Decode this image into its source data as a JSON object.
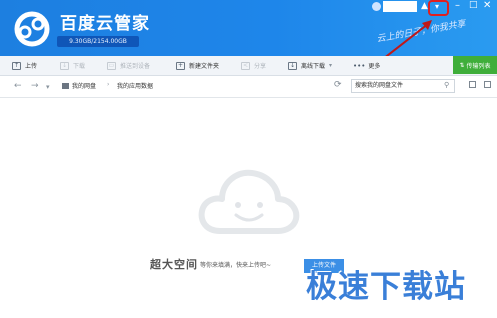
{
  "app": {
    "title": "百度云管家",
    "quota": "9.30GB/2154.00GB",
    "slogan": "云上的日子，你我共享"
  },
  "titlebar": {
    "menu_icon": "▾",
    "min_icon": "–",
    "max_icon": "□",
    "close_icon": "✕"
  },
  "toolbar": {
    "items": [
      {
        "label": "上传",
        "icon": "upload-icon",
        "glyph": "↑",
        "enabled": true
      },
      {
        "label": "下载",
        "icon": "download-icon",
        "glyph": "↓",
        "enabled": false
      },
      {
        "label": "推送到设备",
        "icon": "push-device-icon",
        "glyph": "▭",
        "enabled": false
      },
      {
        "label": "新建文件夹",
        "icon": "new-folder-icon",
        "glyph": "+",
        "enabled": true
      },
      {
        "label": "分享",
        "icon": "share-icon",
        "glyph": "<",
        "enabled": false
      },
      {
        "label": "离线下载",
        "icon": "offline-download-icon",
        "glyph": "↓",
        "enabled": true
      },
      {
        "label": "更多",
        "icon": "more-icon",
        "glyph": "•",
        "enabled": true
      }
    ],
    "transfer_label": "传输列表"
  },
  "addressbar": {
    "breadcrumb": [
      "我的网盘",
      "我的应用数据"
    ],
    "search_placeholder": "搜索我的网盘文件"
  },
  "empty_state": {
    "title": "超大空间",
    "description": "等你来填满，快来上传吧~",
    "upload_button": "上传文件"
  },
  "watermark": "极速下载站",
  "colors": {
    "header_blue": "#1e86ea",
    "transfer_green": "#3fae3a",
    "annotation_red": "#e02020"
  }
}
